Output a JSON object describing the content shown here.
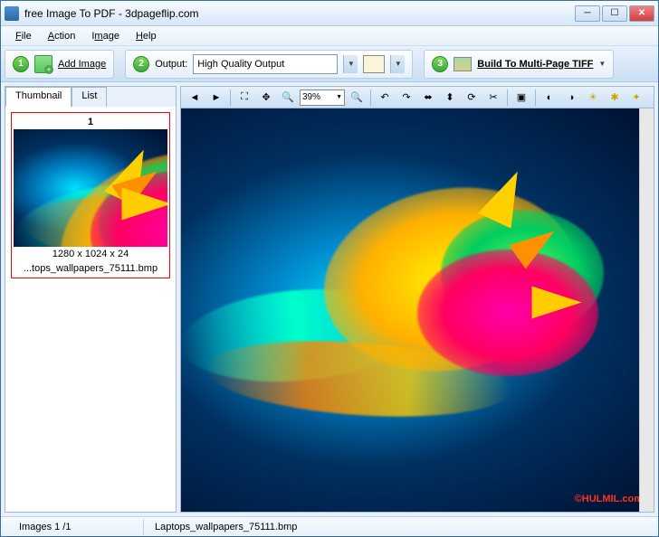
{
  "window": {
    "title": "free Image To PDF - 3dpageflip.com"
  },
  "menu": {
    "file": "File",
    "action": "Action",
    "image": "Image",
    "help": "Help"
  },
  "toolbar": {
    "step1": "1",
    "add_image": "Add Image",
    "step2": "2",
    "output_label": "Output:",
    "output_value": "High Quality Output",
    "step3": "3",
    "build_label": "Build To Multi-Page TIFF"
  },
  "sidebar": {
    "tab_thumb": "Thumbnail",
    "tab_list": "List",
    "thumb": {
      "num": "1",
      "dims": "1280 x 1024 x 24",
      "name": "...tops_wallpapers_75111.bmp"
    }
  },
  "viewtoolbar": {
    "zoom": "39%"
  },
  "preview": {
    "watermark": "©HULMIL.com"
  },
  "status": {
    "images": "Images 1 /1",
    "filename": "Laptops_wallpapers_75111.bmp"
  }
}
